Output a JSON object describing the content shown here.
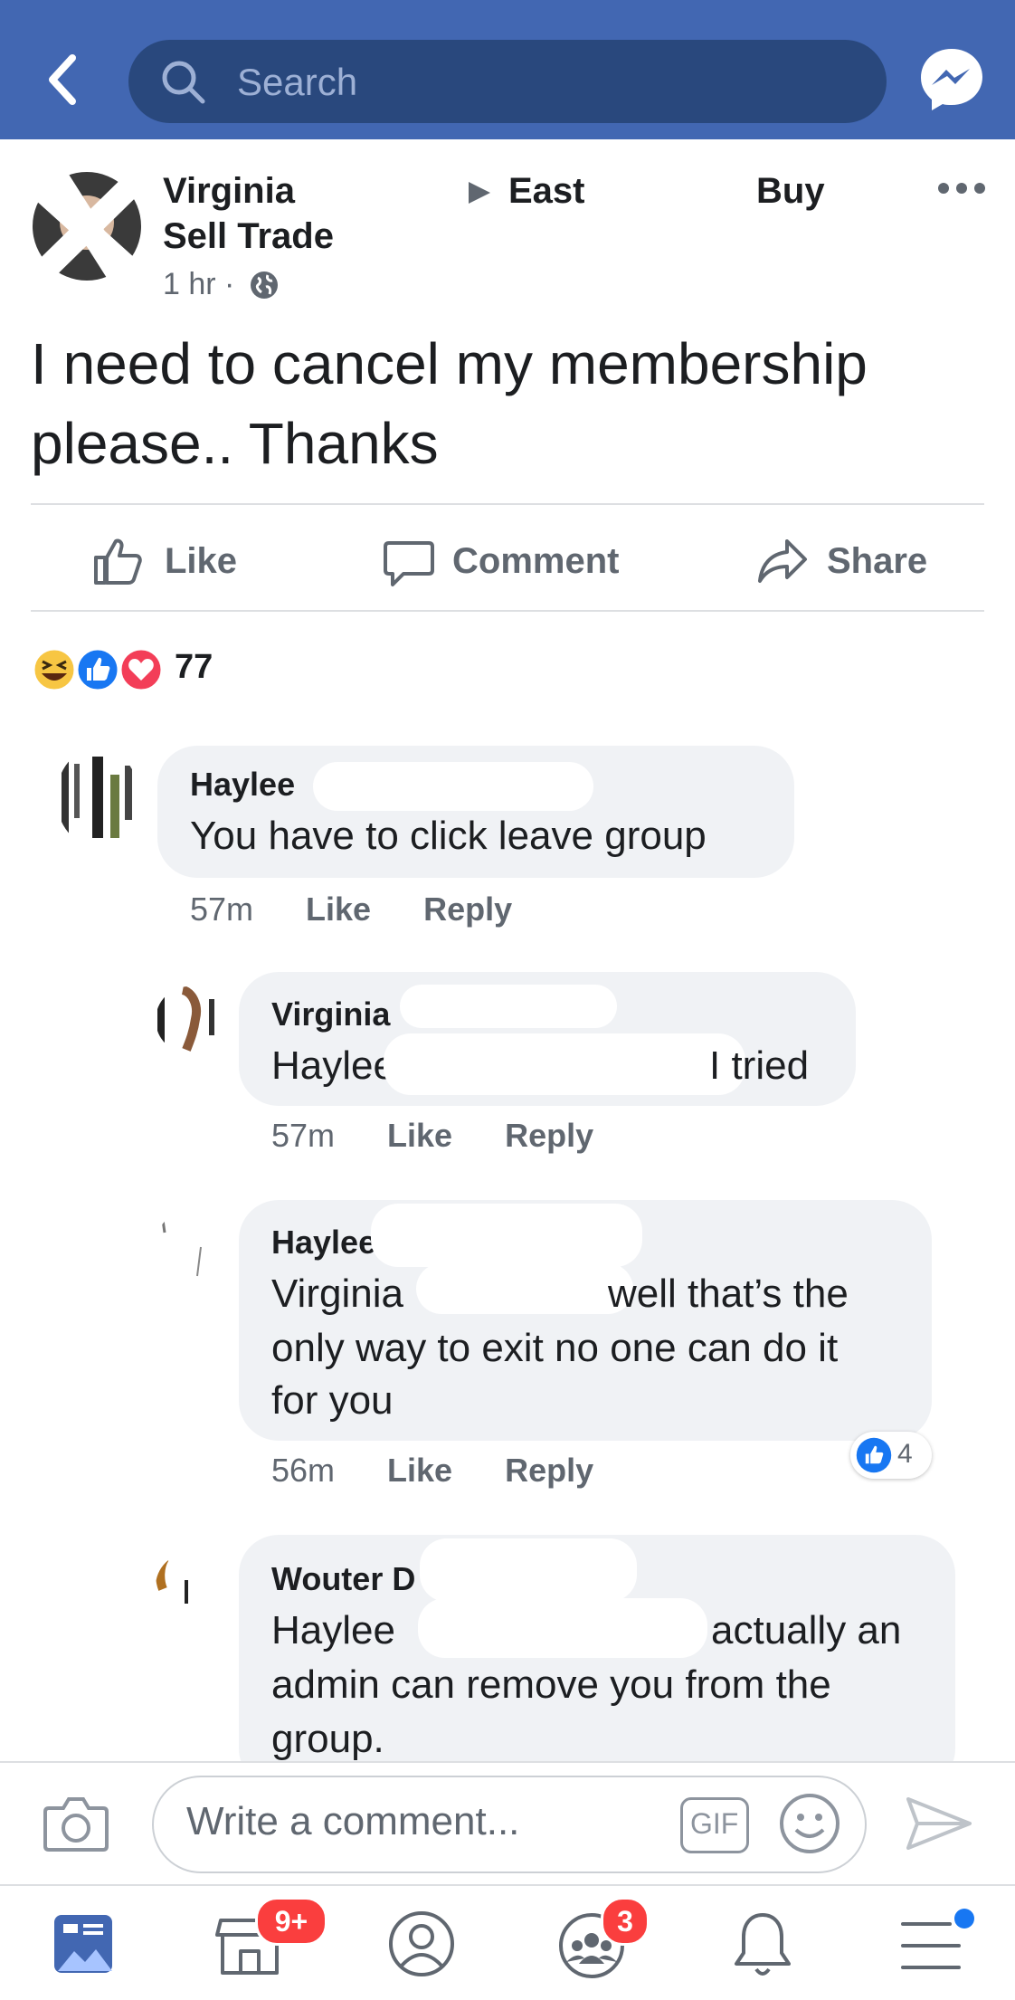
{
  "search": {
    "placeholder": "Search"
  },
  "post": {
    "author": "Virginia",
    "group_name": "East",
    "group_suffix": "Buy",
    "group_line2": "Sell Trade",
    "time": "1 hr ·",
    "text": "I need to cancel my membership please.. Thanks"
  },
  "actions": {
    "like": "Like",
    "comment": "Comment",
    "share": "Share"
  },
  "reactions": {
    "count": "77"
  },
  "comments": [
    {
      "name": "Haylee",
      "text": "You have to click leave group",
      "time": "57m",
      "like": "Like",
      "reply": "Reply"
    },
    {
      "name": "Virginia",
      "tag": "Haylee",
      "text": "I tried",
      "time": "57m",
      "like": "Like",
      "reply": "Reply"
    },
    {
      "name": "Haylee",
      "tag": "Virginia",
      "text_line1": "well that’s the",
      "text_line2": "only way to exit no one can do it",
      "text_line3": "for you",
      "time": "56m",
      "like": "Like",
      "reply": "Reply",
      "like_count": "4"
    },
    {
      "name": "Wouter D",
      "tag": "Haylee",
      "text_line1": "actually an",
      "text_line2": "admin can remove you from the",
      "text_line3": "group."
    }
  ],
  "composer": {
    "placeholder": "Write a comment...",
    "gif_label": "GIF"
  },
  "tabbar": {
    "marketplace_badge": "9+",
    "groups_badge": "3"
  },
  "colors": {
    "brand": "#4267b2",
    "search_bg": "#29487d",
    "badge": "#fa3e3e",
    "like_blue": "#1877f2"
  }
}
